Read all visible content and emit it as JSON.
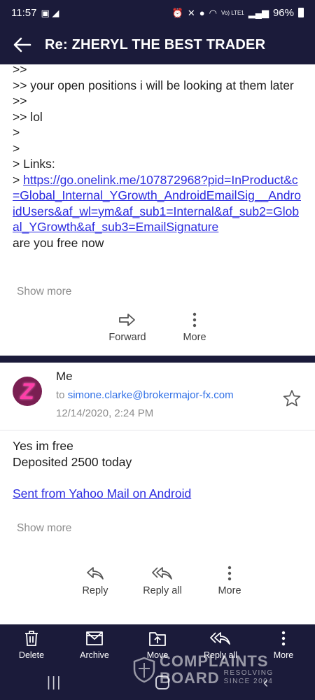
{
  "status_bar": {
    "time": "11:57",
    "battery": "96%",
    "network": "Vo) LTE1"
  },
  "header": {
    "title": "Re: ZHERYL THE BEST TRADER"
  },
  "quoted_message": {
    "lines": [
      ">>",
      ">> your open positions i will be looking at them later",
      ">>",
      ">> lol",
      ">",
      ">",
      "> Links:"
    ],
    "link_prefix": "> ",
    "link": "https://go.onelink.me/107872968?pid=InProduct&c=Global_Internal_YGrowth_AndroidEmailSig__AndroidUsers&af_wl=ym&af_sub1=Internal&af_sub2=Global_YGrowth&af_sub3=EmailSignature",
    "after_link": "are you free now",
    "show_more": "Show more",
    "actions": {
      "forward": "Forward",
      "more": "More"
    }
  },
  "message": {
    "sender": "Me",
    "to_label": "to",
    "to_email": "simone.clarke@brokermajor-fx.com",
    "date": "12/14/2020, 2:24 PM",
    "avatar_letter": "Z",
    "body_lines": [
      "Yes im free",
      "Deposited 2500 today"
    ],
    "signature_link": "Sent from Yahoo Mail on Android",
    "show_more": "Show more",
    "actions": {
      "reply": "Reply",
      "reply_all": "Reply all",
      "more": "More"
    }
  },
  "bottom_bar": {
    "delete": "Delete",
    "archive": "Archive",
    "move": "Move",
    "reply_all": "Reply all",
    "more": "More"
  },
  "watermark": {
    "line1": "COMPLAINTS",
    "line2": "BOARD",
    "line3": "RESOLVING SINCE 2004"
  },
  "colors": {
    "bar": "#1b1b3a",
    "link": "#2a2ae0",
    "email": "#2f6fe6"
  }
}
